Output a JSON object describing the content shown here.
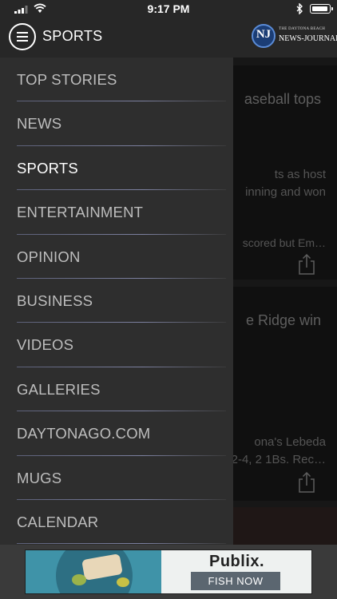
{
  "status_bar": {
    "time": "9:17 PM"
  },
  "header": {
    "section_title": "SPORTS",
    "logo_letters": "NJ",
    "logo_small_text": "THE DAYTONA BEACH",
    "logo_big_text": "NEWS-JOURNAL"
  },
  "drawer": {
    "items": [
      {
        "label": "TOP STORIES",
        "active": false
      },
      {
        "label": "NEWS",
        "active": false
      },
      {
        "label": "SPORTS",
        "active": true
      },
      {
        "label": "ENTERTAINMENT",
        "active": false
      },
      {
        "label": "OPINION",
        "active": false
      },
      {
        "label": "BUSINESS",
        "active": false
      },
      {
        "label": "VIDEOS",
        "active": false
      },
      {
        "label": "GALLERIES",
        "active": false
      },
      {
        "label": "DAYTONAGO.COM",
        "active": false
      },
      {
        "label": "MUGS",
        "active": false
      },
      {
        "label": "CALENDAR",
        "active": false
      }
    ]
  },
  "background_cards": [
    {
      "title_fragment": "aseball tops",
      "summary_line1": "ts as host",
      "summary_line2": "inning and won",
      "meta_fragment": "scored but Em…"
    },
    {
      "title_fragment": "e Ridge win",
      "summary_line1": "ona's Lebeda",
      "summary_line2": "2-4, 2 1Bs. Rec…"
    }
  ],
  "ad": {
    "brand": "Publix.",
    "cta": "FISH NOW"
  },
  "colors": {
    "bar_background": "#272727",
    "drawer_background": "#2e2e2e",
    "drawer_text": "#bdbdbd",
    "drawer_active_text": "#ffffff",
    "divider": "#7d81a0",
    "logo_blue": "#1b3d75"
  }
}
